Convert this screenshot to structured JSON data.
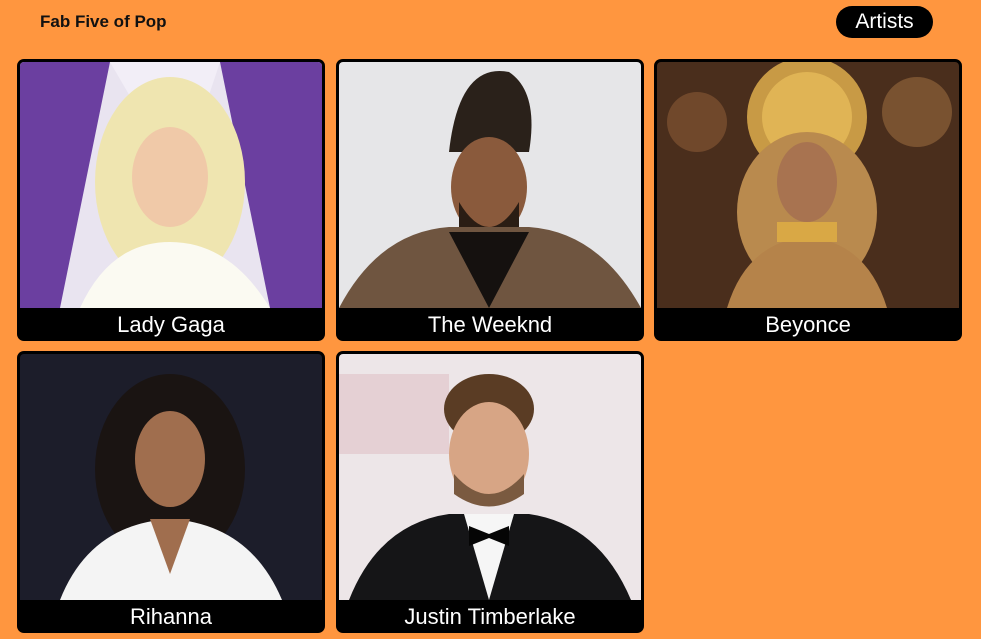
{
  "header": {
    "title": "Fab Five of Pop",
    "nav_label": "Artists"
  },
  "artists": [
    {
      "name": "Lady Gaga"
    },
    {
      "name": "The Weeknd"
    },
    {
      "name": "Beyonce"
    },
    {
      "name": "Rihanna"
    },
    {
      "name": "Justin Timberlake"
    }
  ],
  "colors": {
    "background": "#FF963F",
    "card": "#000000",
    "caption_text": "#FFFFFF"
  }
}
